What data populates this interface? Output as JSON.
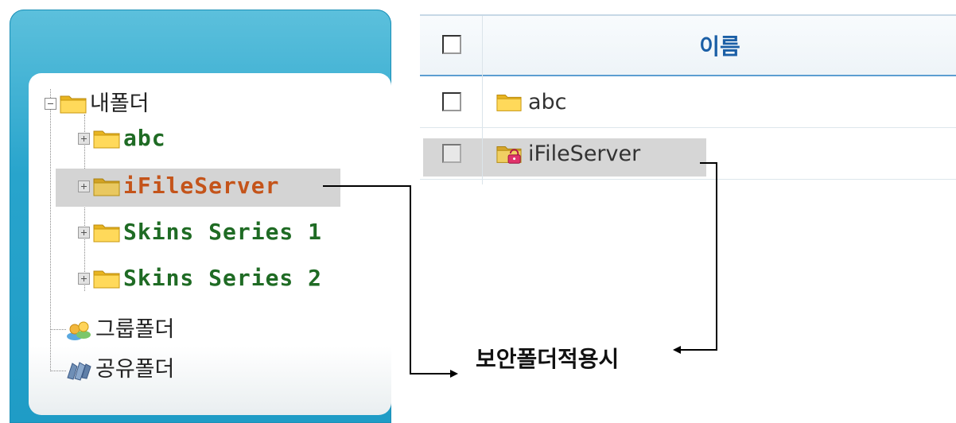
{
  "tree": {
    "root": "내폴더",
    "children": [
      "abc",
      "iFileServer",
      "Skins Series 1",
      "Skins Series 2"
    ],
    "selected": "iFileServer",
    "group_folder": "그룹폴더",
    "shared_folder": "공유폴더"
  },
  "list": {
    "header_name": "이름",
    "rows": [
      {
        "name": "abc",
        "icon": "folder-icon"
      },
      {
        "name": "iFileServer",
        "icon": "secure-folder-icon",
        "selected": true
      }
    ]
  },
  "annotation": "보안폴더적용시",
  "colors": {
    "panel_blue": "#28a4cc",
    "header_text": "#1b5fa6",
    "child_label": "#1f6b24",
    "selected_label": "#c4541a",
    "selection_bg": "#d4d4d4"
  }
}
